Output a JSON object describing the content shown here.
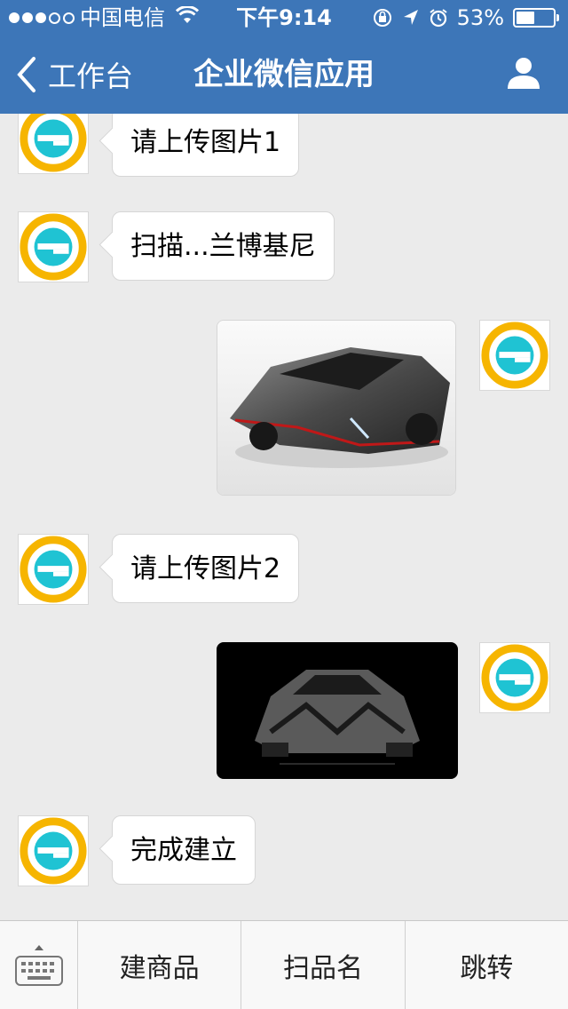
{
  "status_bar": {
    "carrier": "中国电信",
    "time": "下午9:14",
    "battery": "53%",
    "battery_level": 0.53
  },
  "nav": {
    "back_label": "工作台",
    "title": "企业微信应用"
  },
  "messages": [
    {
      "side": "left",
      "type": "text",
      "text": "请上传图片1"
    },
    {
      "side": "left",
      "type": "text",
      "text": "扫描...兰博基尼"
    },
    {
      "side": "right",
      "type": "image",
      "image": "silver-sports-car-white-background"
    },
    {
      "side": "left",
      "type": "text",
      "text": "请上传图片2"
    },
    {
      "side": "right",
      "type": "image",
      "image": "silver-sports-car-black-background"
    },
    {
      "side": "left",
      "type": "text",
      "text": "完成建立"
    }
  ],
  "bottom_menu": {
    "items": [
      "建商品",
      "扫品名",
      "跳转"
    ]
  },
  "colors": {
    "header_blue": "#3d76b8",
    "chat_bg": "#ebebeb",
    "avatar_cyan": "#1fc3d3",
    "avatar_gold": "#f6b500"
  }
}
